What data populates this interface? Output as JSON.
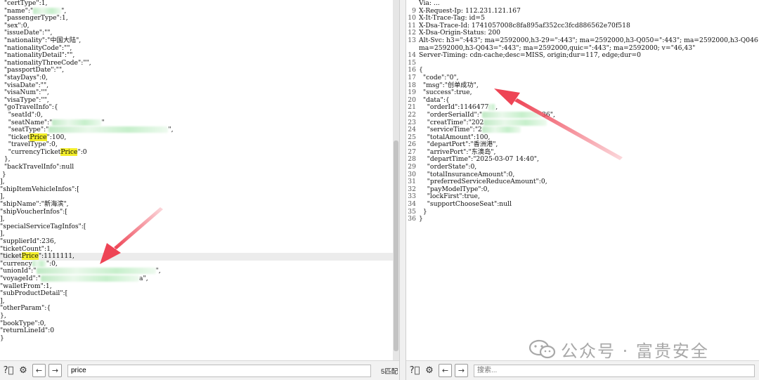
{
  "left_pane": {
    "lines": [
      {
        "text": "  \"certType\":1,"
      },
      {
        "text": "  \"name\":\"",
        "blur": 40,
        "after": "\","
      },
      {
        "text": "  \"passengerType\":1,"
      },
      {
        "text": "  \"sex\":0,"
      },
      {
        "text": "  \"issueDate\":\"\","
      },
      {
        "text": "  \"nationality\":\"中国大陆\","
      },
      {
        "text": "  \"nationalityCode\":\"\","
      },
      {
        "text": "  \"nationalityDetail\":\"\","
      },
      {
        "text": "  \"nationalityThreeCode\":\"\","
      },
      {
        "text": "  \"passportDate\":\"\","
      },
      {
        "text": "  \"stayDays\":0,"
      },
      {
        "text": "  \"visaDate\":\"\","
      },
      {
        "text": "  \"visaNum\":\"\","
      },
      {
        "text": "  \"visaType\":\"\","
      },
      {
        "text": "  \"goTravelInfo\":{"
      },
      {
        "text": "    \"seatId\":0,"
      },
      {
        "text": "    \"seatName\":\"",
        "blur": 70,
        "after": "\""
      },
      {
        "text": "    \"seatType\":\"",
        "blur": 170,
        "after": "\","
      },
      {
        "text": "    \"ticket",
        "hl": "Price",
        "after": "\":100,"
      },
      {
        "text": "    \"travelType\":0,"
      },
      {
        "text": "    \"currencyTicket",
        "hl": "Price",
        "after": "\":0"
      },
      {
        "text": "  },"
      },
      {
        "text": "  \"backTravelInfo\":null"
      },
      {
        "text": " }"
      },
      {
        "text": "],"
      },
      {
        "text": "\"shipItemVehicleInfos\":["
      },
      {
        "text": "],"
      },
      {
        "text": "\"shipName\":\"新海滨\","
      },
      {
        "text": "\"shipVoucherInfos\":["
      },
      {
        "text": "],"
      },
      {
        "text": "\"specialServiceTagInfos\":["
      },
      {
        "text": "],"
      },
      {
        "text": "\"supplierId\":236,"
      },
      {
        "text": "\"ticketCount\":1,"
      },
      {
        "text": "\"ticket",
        "hl": "Price",
        "after": "\":1111111,",
        "current": true
      },
      {
        "text": "\"currency",
        "blur": 20,
        "after": "\":0,"
      },
      {
        "text": "\"unionId\":\"",
        "blur": 170,
        "after": "\","
      },
      {
        "text": "\"voyageId\":\"",
        "blur": 140,
        "after": "a\","
      },
      {
        "text": "\"walletFrom\":1,"
      },
      {
        "text": "\"subProductDetail\":["
      },
      {
        "text": "],"
      },
      {
        "text": "\"otherParam\":{"
      },
      {
        "text": "},"
      },
      {
        "text": "\"bookType\":0,"
      },
      {
        "text": "\"returnLineId\":0"
      },
      {
        "text": "}"
      }
    ]
  },
  "right_pane": {
    "lines": [
      {
        "num": "",
        "text": "Via: ..."
      },
      {
        "num": "9",
        "text": "X-Request-Ip: 112.231.121.167"
      },
      {
        "num": "10",
        "text": "X-It-Trace-Tag: id=5"
      },
      {
        "num": "11",
        "text": "X-Dsa-Trace-Id: 1741057008c8fa895af352cc3fcd886562e70f518"
      },
      {
        "num": "12",
        "text": "X-Dsa-Origin-Status: 200"
      },
      {
        "num": "13",
        "text": "Alt-Svc: h3=\":443\"; ma=2592000,h3-29=\":443\"; ma=2592000,h3-Q050=\":443\"; ma=2592000,h3-Q046=\":443\";"
      },
      {
        "num": "",
        "text": "ma=2592000,h3-Q043=\":443\"; ma=2592000,quic=\":443\"; ma=2592000; v=\"46,43\""
      },
      {
        "num": "14",
        "text": "Server-Timing: cdn-cache;desc=MISS, origin;dur=117, edge;dur=0"
      },
      {
        "num": "15",
        "text": ""
      },
      {
        "num": "16",
        "text": "{"
      },
      {
        "num": "17",
        "text": "  \"code\":\"0\","
      },
      {
        "num": "18",
        "text": "  \"msg\":\"创单成功\","
      },
      {
        "num": "19",
        "text": "  \"success\":true,"
      },
      {
        "num": "20",
        "text": "  \"data\":{"
      },
      {
        "num": "21",
        "text": "    \"orderId\":1146477",
        "blur": 10,
        "after": ","
      },
      {
        "num": "22",
        "text": "    \"orderSerialId\":\"",
        "blur": 85,
        "after": "36\","
      },
      {
        "num": "23",
        "text": "    \"creatTime\":\"202",
        "blur": 90,
        "after": ""
      },
      {
        "num": "24",
        "text": "    \"serviceTime\":\"2",
        "blur": 55,
        "after": ""
      },
      {
        "num": "25",
        "text": "    \"totalAmount\":100,"
      },
      {
        "num": "26",
        "text": "    \"departPort\":\"香洲港\","
      },
      {
        "num": "27",
        "text": "    \"arrivePort\":\"东澳岛\","
      },
      {
        "num": "28",
        "text": "    \"departTime\":\"2025-03-07 14:40\","
      },
      {
        "num": "29",
        "text": "    \"orderState\":0,"
      },
      {
        "num": "30",
        "text": "    \"totalInsuranceAmount\":0,"
      },
      {
        "num": "31",
        "text": "    \"preferredServiceReduceAmount\":0,"
      },
      {
        "num": "32",
        "text": "    \"payModelType\":0,"
      },
      {
        "num": "33",
        "text": "    \"lockFirst\":true,"
      },
      {
        "num": "34",
        "text": "    \"supportChooseSeat\":null"
      },
      {
        "num": "35",
        "text": "  }"
      },
      {
        "num": "36",
        "text": "}"
      }
    ]
  },
  "left_toolbar": {
    "help_icon": "help-icon",
    "settings_icon": "gear-icon",
    "prev_label": "←",
    "next_label": "→",
    "search_value": "price",
    "match_count": "5匹配"
  },
  "right_toolbar": {
    "help_icon": "help-icon",
    "settings_icon": "gear-icon",
    "prev_label": "←",
    "next_label": "→",
    "search_placeholder": "搜索..."
  },
  "watermark": {
    "text": "公众号 · 富贵安全"
  },
  "colors": {
    "highlight": "#f3ee2a",
    "string_green": "#2e8b57",
    "arrow_red": "#ee4455"
  }
}
